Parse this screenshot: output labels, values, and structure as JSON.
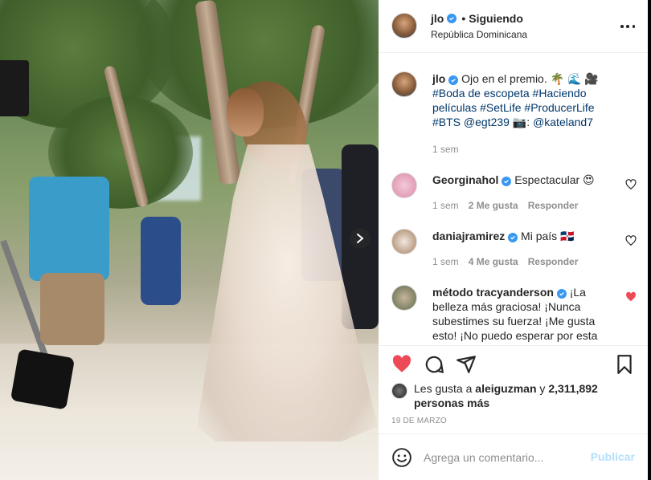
{
  "post": {
    "author": "jlo",
    "follow_separator": "•",
    "follow_status": "Siguiendo",
    "location": "República Dominicana",
    "more_icon": "more-horizontal-icon"
  },
  "caption": {
    "author": "jlo",
    "text_lead": "Ojo en el premio. 🌴 🌊 🎥",
    "hashtags_line": "#Boda de escopeta #Haciendo películas #SetLife #ProducerLife #BTS",
    "mention_1": "@egt239",
    "camera_emoji": "📷",
    "colon": ":",
    "mention_2": "@kateland7",
    "time": "1 sem"
  },
  "comments": [
    {
      "user": "Georginahol",
      "text": "Espectacular 😍",
      "time": "1 sem",
      "likes": "2 Me gusta",
      "reply": "Responder",
      "liked": false
    },
    {
      "user": "daniajramirez",
      "text": "Mi país 🇩🇴",
      "time": "1 sem",
      "likes": "4 Me gusta",
      "reply": "Responder",
      "liked": false
    },
    {
      "user": "método tracyanderson",
      "text": "¡La belleza más graciosa! ¡Nunca subestimes su fuerza! ¡Me gusta esto! ¡No puedo esperar por esta",
      "liked": true
    }
  ],
  "likes": {
    "prefix": "Les gusta a",
    "user": "aleiguzman",
    "suffix": "y",
    "count": "2,311,892",
    "count_suffix": "personas más"
  },
  "date": "19 DE MARZO",
  "add_comment": {
    "placeholder": "Agrega un comentario...",
    "publish_label": "Publicar"
  },
  "colors": {
    "verified": "#3897f0",
    "like_red": "#ed4956",
    "hashtag": "#00376b",
    "publish_disabled": "#b2dffc",
    "meta_gray": "#8e8e8e"
  }
}
